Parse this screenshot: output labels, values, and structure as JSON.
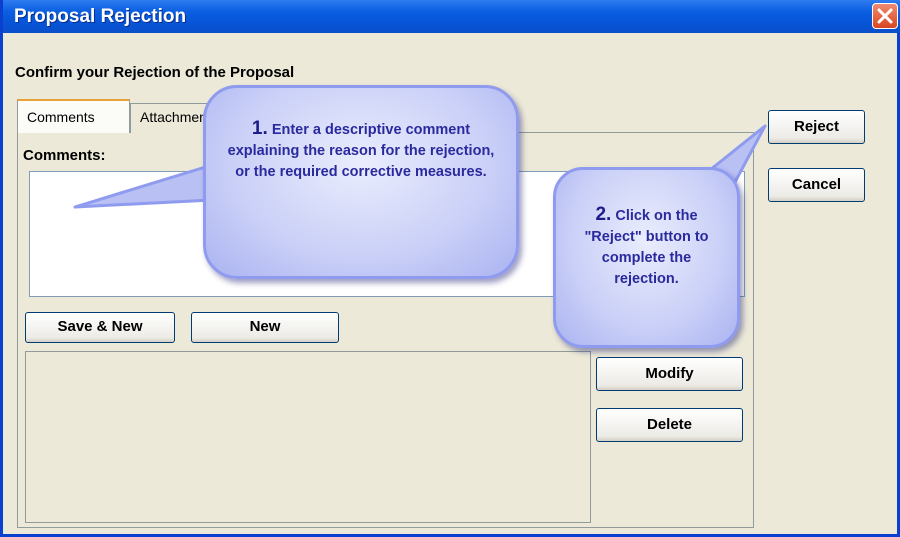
{
  "window": {
    "title": "Proposal Rejection"
  },
  "header": {
    "subtitle": "Confirm your Rejection of the Proposal"
  },
  "tabs": [
    {
      "label": "Comments"
    },
    {
      "label": "Attachments"
    }
  ],
  "comments": {
    "label": "Comments:",
    "value": ""
  },
  "buttons": {
    "reject": "Reject",
    "cancel": "Cancel",
    "save_new": "Save & New",
    "new": "New",
    "modify": "Modify",
    "delete": "Delete"
  },
  "callouts": {
    "one_num": "1.",
    "one_text": "Enter a descriptive comment explaining the reason for the rejection, or the required corrective measures.",
    "two_num": "2.",
    "two_text": "Click on the \"Reject\" button to complete the rejection."
  },
  "colors": {
    "titlebar": "#0754d7",
    "window_bg": "#ece9d8",
    "callout_text": "#2a2a9e"
  },
  "icons": {
    "close": "close-icon"
  }
}
